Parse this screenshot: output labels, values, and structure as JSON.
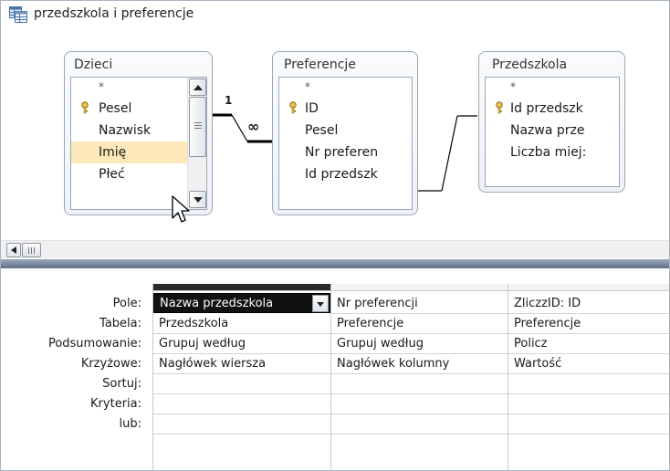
{
  "window": {
    "title": "przedszkola i preferencje"
  },
  "tables": [
    {
      "title": "Dzieci",
      "fields": [
        "*",
        "Pesel",
        "Nazwisk",
        "Imię",
        "Płeć"
      ]
    },
    {
      "title": "Preferencje",
      "fields": [
        "*",
        "ID",
        "Pesel",
        "Nr preferen",
        "Id przedszk"
      ]
    },
    {
      "title": "Przedszkola",
      "fields": [
        "*",
        "Id przedszk",
        "Nazwa prze",
        "Liczba miej:"
      ]
    }
  ],
  "relationship": {
    "one_label": "1",
    "many_label": "∞"
  },
  "grid": {
    "row_labels": [
      "Pole:",
      "Tabela:",
      "Podsumowanie:",
      "Krzyżowe:",
      "Sortuj:",
      "Kryteria:",
      "lub:"
    ],
    "columns": [
      {
        "field": "Nazwa przedszkola",
        "table": "Przedszkola",
        "total": "Grupuj według",
        "crosstab": "Nagłówek wiersza"
      },
      {
        "field": "Nr preferencji",
        "table": "Preferencje",
        "total": "Grupuj według",
        "crosstab": "Nagłówek kolumny"
      },
      {
        "field": "ZliczzID: ID",
        "table": "Preferencje",
        "total": "Policz",
        "crosstab": "Wartość"
      }
    ]
  },
  "colors": {
    "selected_field": "#fde8ba",
    "splitter": "#7d8ea5",
    "selected_cell": "#111111"
  }
}
